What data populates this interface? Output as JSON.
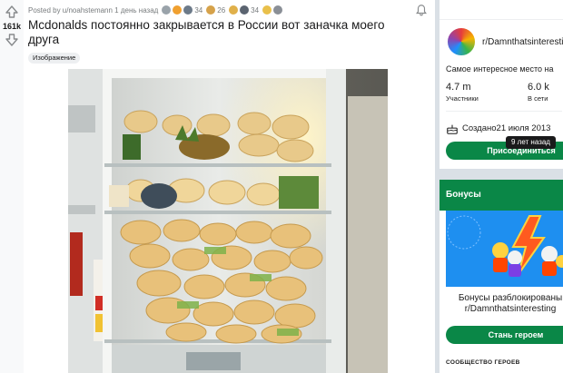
{
  "post": {
    "score": "161k",
    "meta_text": "Posted by u/noahstemann 1 день назад",
    "awards": [
      {
        "name": "award-1",
        "color": "#9aa3aa",
        "count": ""
      },
      {
        "name": "award-2",
        "color": "#f0a030",
        "count": ""
      },
      {
        "name": "award-3",
        "color": "#6c7a89",
        "count": "34"
      },
      {
        "name": "award-4",
        "color": "#d6a24a",
        "count": "26"
      },
      {
        "name": "award-5",
        "color": "#e0b04a",
        "count": ""
      },
      {
        "name": "award-6",
        "color": "#5b6470",
        "count": "34"
      },
      {
        "name": "award-7",
        "color": "#e9c04b",
        "count": ""
      },
      {
        "name": "award-8",
        "color": "#8a8f96",
        "count": ""
      }
    ],
    "title": "Mcdonalds постоянно закрывается в России вот заначка моего друга",
    "flair": "Изображение"
  },
  "sidebar": {
    "subreddit_name": "r/Damnthatsinteresting",
    "description": "Самое интересное место на",
    "members_value": "4.7 m",
    "members_label": "Участники",
    "online_value": "6.0 k",
    "online_label": "В сети",
    "created_text": "Создано21 июля 2013",
    "tooltip": "9 лет назад",
    "join_label": "Присоединиться",
    "bonus_header": "Бонусы",
    "bonus_text_line1": "Бонусы разблокированы",
    "bonus_text_line2": "r/Damnthatsinteresting",
    "hero_button": "Стань героем",
    "community_heroes": "СООБЩЕСТВО ГЕРОЕВ"
  },
  "colors": {
    "accent_green": "#0a8747",
    "bonus_blue": "#1e8ff0"
  }
}
